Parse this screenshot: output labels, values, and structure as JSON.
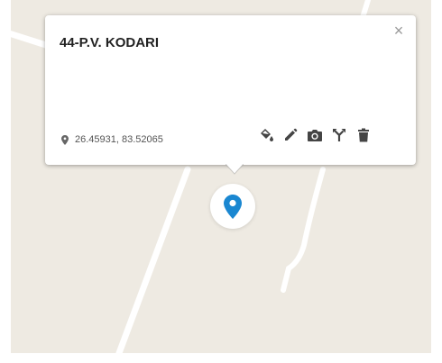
{
  "popup": {
    "title": "44-P.V. KODARI",
    "close_glyph": "×",
    "coordinates": "26.45931, 83.52065",
    "tools": [
      {
        "name": "fill-color-icon",
        "title": "Fill color"
      },
      {
        "name": "edit-pencil-icon",
        "title": "Edit"
      },
      {
        "name": "camera-icon",
        "title": "Add photo"
      },
      {
        "name": "route-fork-icon",
        "title": "Directions"
      },
      {
        "name": "trash-icon",
        "title": "Delete"
      }
    ]
  },
  "colors": {
    "map_background": "#eeeae2",
    "road": "#ffffff",
    "marker": "#1a87d1",
    "icon": "#444444"
  }
}
